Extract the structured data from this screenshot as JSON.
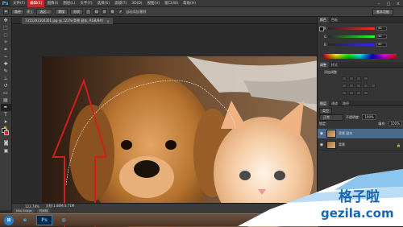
{
  "app": {
    "logo": "Ps"
  },
  "menubar": {
    "items": [
      "文件(F)",
      "编辑(E)",
      "图像(I)",
      "图层(L)",
      "文字(Y)",
      "选择(S)",
      "滤镜(T)",
      "3D(D)",
      "视图(V)",
      "窗口(W)",
      "帮助(H)"
    ],
    "active_index": 1,
    "win_minimize": "–",
    "win_restore": "□",
    "win_close": "×"
  },
  "optionsbar": {
    "mode_label": "路径",
    "make_label": "建立:",
    "selection_btn": "选区...",
    "mask_btn": "蒙版",
    "shape_btn": "形状",
    "auto_label": "自动添加/删除",
    "essentials": "基本功能"
  },
  "document": {
    "tab_title": "7355392304301.jpg @ 122%(背景 副本, RGB/8#)",
    "tab_close": "×",
    "zoom": "122.78%",
    "doc_info": "文档:1.86M/3.71M"
  },
  "minibridge": {
    "tab1": "Mini Bridge",
    "tab2": "时间轴"
  },
  "panels": {
    "color": {
      "tab_color": "颜色",
      "tab_swatches": "色板",
      "r": "R",
      "g": "G",
      "b": "B",
      "r_val": "40",
      "g_val": "40",
      "b_val": "40"
    },
    "adjustments": {
      "tab_adjust": "调整",
      "tab_styles": "样式",
      "title": "添加调整"
    },
    "layers": {
      "tab_layers": "图层",
      "tab_channels": "通道",
      "tab_paths": "路径",
      "kind_label": "类型",
      "blend_mode": "正常",
      "opacity_label": "不透明度:",
      "opacity_value": "100%",
      "lock_label": "锁定:",
      "fill_label": "填充:",
      "fill_value": "100%",
      "items": [
        {
          "name": "背景 副本",
          "selected": true
        },
        {
          "name": "背景",
          "selected": false
        }
      ],
      "lock_glyph": "🔒"
    }
  },
  "taskbar": {
    "btn_ie": "e",
    "btn_ps": "Ps"
  },
  "watermark": {
    "text_cn": "格子啦",
    "text_en": "gezila.com"
  },
  "colors": {
    "accent": "#c22a2a",
    "fg": "#111111",
    "bg": "#d52222",
    "layer_sel": "#4a6a8c",
    "watermark": "#1566b5"
  }
}
